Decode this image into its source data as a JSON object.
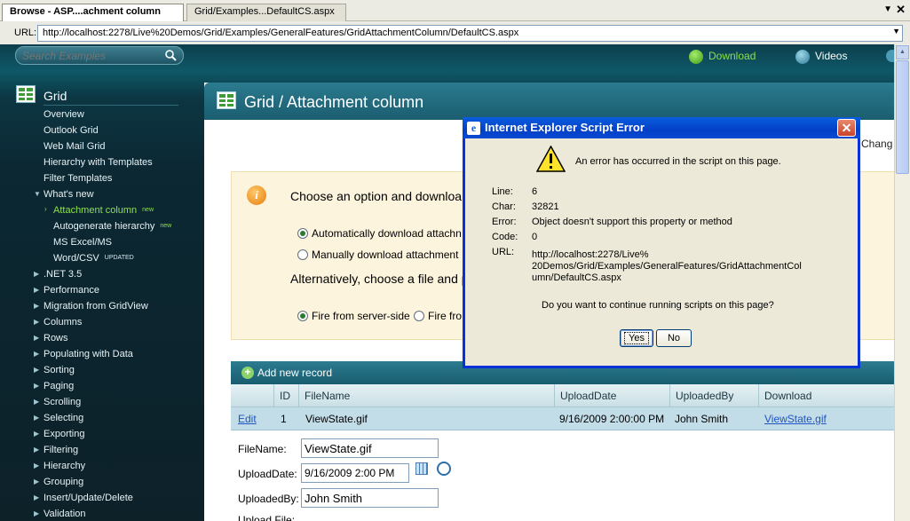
{
  "browser": {
    "tabs": [
      {
        "label": "Browse - ASP....achment column"
      },
      {
        "label": "Grid/Examples...DefaultCS.aspx"
      }
    ],
    "url_label": "URL:",
    "url": "http://localhost:2278/Live%20Demos/Grid/Examples/GeneralFeatures/GridAttachmentColumn/DefaultCS.aspx"
  },
  "topbar": {
    "search_placeholder": "Search Examples",
    "download_label": "Download",
    "videos_label": "Videos"
  },
  "sidebar": {
    "title": "Grid",
    "items": [
      {
        "label": "Overview"
      },
      {
        "label": "Outlook Grid"
      },
      {
        "label": "Web Mail Grid"
      },
      {
        "label": "Hierarchy with Templates"
      },
      {
        "label": "Filter Templates"
      },
      {
        "label": "What's new"
      },
      {
        "label": "Attachment column",
        "badge": "new"
      },
      {
        "label": "Autogenerate hierarchy",
        "badge": "new"
      },
      {
        "label": "MS Excel/MS"
      },
      {
        "label": "Word/CSV",
        "badge": "UPDATED"
      },
      {
        "label": ".NET 3.5"
      },
      {
        "label": "Performance"
      },
      {
        "label": "Migration from GridView"
      },
      {
        "label": "Columns"
      },
      {
        "label": "Rows"
      },
      {
        "label": "Populating with Data"
      },
      {
        "label": "Sorting"
      },
      {
        "label": "Paging"
      },
      {
        "label": "Scrolling"
      },
      {
        "label": "Selecting"
      },
      {
        "label": "Exporting"
      },
      {
        "label": "Filtering"
      },
      {
        "label": "Hierarchy"
      },
      {
        "label": "Grouping"
      },
      {
        "label": "Insert/Update/Delete"
      },
      {
        "label": "Validation"
      }
    ]
  },
  "content": {
    "title": "Grid / Attachment column",
    "change_label": "Chang",
    "info_text": "Choose an option and downloa",
    "radio_auto": "Automatically download attachn",
    "radio_manual": "Manually download attachment",
    "alt_text": "Alternatively, choose a file and p",
    "radio_server": "Fire from server-side",
    "radio_client": "Fire fro",
    "add_record": "Add new record",
    "columns": [
      "ID",
      "FileName",
      "UploadDate",
      "UploadedBy",
      "Download"
    ],
    "row": {
      "edit": "Edit",
      "id": "1",
      "filename": "ViewState.gif",
      "uploaddate": "9/16/2009 2:00:00 PM",
      "uploadedby": "John Smith",
      "download": "ViewState.gif"
    },
    "form": {
      "filename_label": "FileName:",
      "filename_value": "ViewState.gif",
      "uploaddate_label": "UploadDate:",
      "uploaddate_value": "9/16/2009 2:00 PM",
      "uploadedby_label": "UploadedBy:",
      "uploadedby_value": "John Smith",
      "uploadfile_label": "Upload File:"
    }
  },
  "dialog": {
    "title": "Internet Explorer Script Error",
    "message": "An error has occurred in the script on this page.",
    "line_label": "Line:",
    "line_value": "6",
    "char_label": "Char:",
    "char_value": "32821",
    "error_label": "Error:",
    "error_value": "Object doesn't support this property or method",
    "code_label": "Code:",
    "code_value": "0",
    "url_label": "URL:",
    "url_value": "http://localhost:2278/Live% 20Demos/Grid/Examples/GeneralFeatures/GridAttachmentCol umn/DefaultCS.aspx",
    "question": "Do you want to continue running scripts on this page?",
    "yes_label": "Yes",
    "no_label": "No"
  }
}
